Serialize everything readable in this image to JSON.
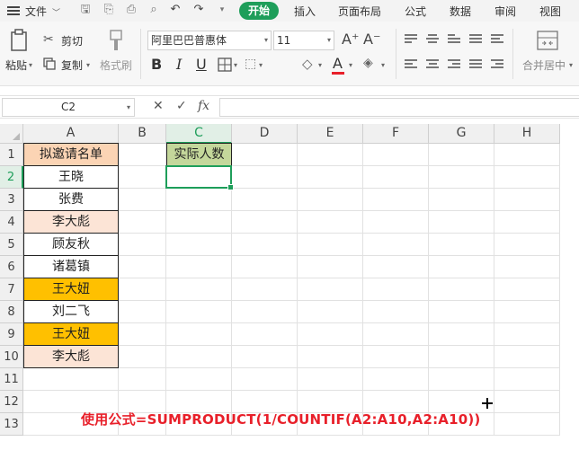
{
  "menu": {
    "file": "文件",
    "tabs": [
      "开始",
      "插入",
      "页面布局",
      "公式",
      "数据",
      "审阅",
      "视图"
    ],
    "active_tab": "开始"
  },
  "ribbon": {
    "paste": "粘贴",
    "cut": "剪切",
    "copy": "复制",
    "format_painter": "格式刷",
    "font_name": "阿里巴巴普惠体",
    "font_size": "11",
    "merge_center": "合并居中",
    "bold": "B",
    "italic": "I",
    "underline": "U",
    "increase_font": "A⁺",
    "decrease_font": "A⁻",
    "font_color_letter": "A"
  },
  "formula_bar": {
    "name_box": "C2",
    "fx": "fx",
    "content": ""
  },
  "grid": {
    "columns": [
      "A",
      "B",
      "C",
      "D",
      "E",
      "F",
      "G",
      "H"
    ],
    "active_column": "C",
    "rows": [
      "1",
      "2",
      "3",
      "4",
      "5",
      "6",
      "7",
      "8",
      "9",
      "10",
      "11",
      "12",
      "13"
    ],
    "active_row": "2",
    "column_a": [
      "拟邀请名单",
      "王晓",
      "张费",
      "李大彪",
      "顾友秋",
      "诸葛镇",
      "王大妞",
      "刘二飞",
      "王大妞",
      "李大彪"
    ],
    "c1": "实际人数",
    "selected_cell": "C2"
  },
  "annotation": "使用公式=SUMPRODUCT(1/COUNTIF(A2:A10,A2:A10))",
  "colors": {
    "accent": "#1e9e5a",
    "header_fill": "#fbd4b4",
    "light_peach": "#fce4d6",
    "orange": "#ffc000",
    "c1_fill": "#c4d79b",
    "annotation_red": "#e8202a"
  },
  "icons": [
    "menu-icon",
    "save-icon",
    "print-icon",
    "undo-icon",
    "redo-icon",
    "scissors-icon",
    "copy-icon",
    "paint-brush-icon",
    "border-icon",
    "fill-color-icon",
    "clear-icon",
    "align-icon",
    "merge-icon",
    "cross-cursor-icon"
  ]
}
